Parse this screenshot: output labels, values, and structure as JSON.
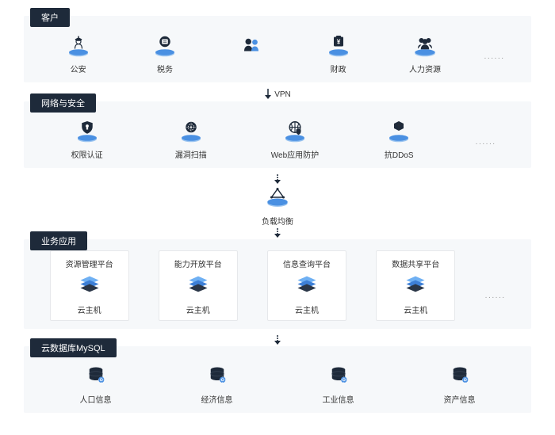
{
  "tiers": {
    "customer": {
      "label": "客户",
      "items": [
        "公安",
        "税务",
        "",
        "财政",
        "人力资源"
      ],
      "more": "······"
    },
    "network": {
      "label": "网络与安全",
      "items": [
        "权限认证",
        "漏洞扫描",
        "Web应用防护",
        "抗DDoS"
      ],
      "more": "······"
    },
    "lb": {
      "label": "负载均衡"
    },
    "app": {
      "label": "业务应用",
      "cards": [
        {
          "title": "资源管理平台",
          "sub": "云主机"
        },
        {
          "title": "能力开放平台",
          "sub": "云主机"
        },
        {
          "title": "信息查询平台",
          "sub": "云主机"
        },
        {
          "title": "数据共享平台",
          "sub": "云主机"
        }
      ],
      "more": "······"
    },
    "db": {
      "label": "云数据库MySQL",
      "items": [
        "人口信息",
        "经济信息",
        "工业信息",
        "资产信息"
      ]
    }
  },
  "conn": {
    "vpn": "VPN"
  }
}
